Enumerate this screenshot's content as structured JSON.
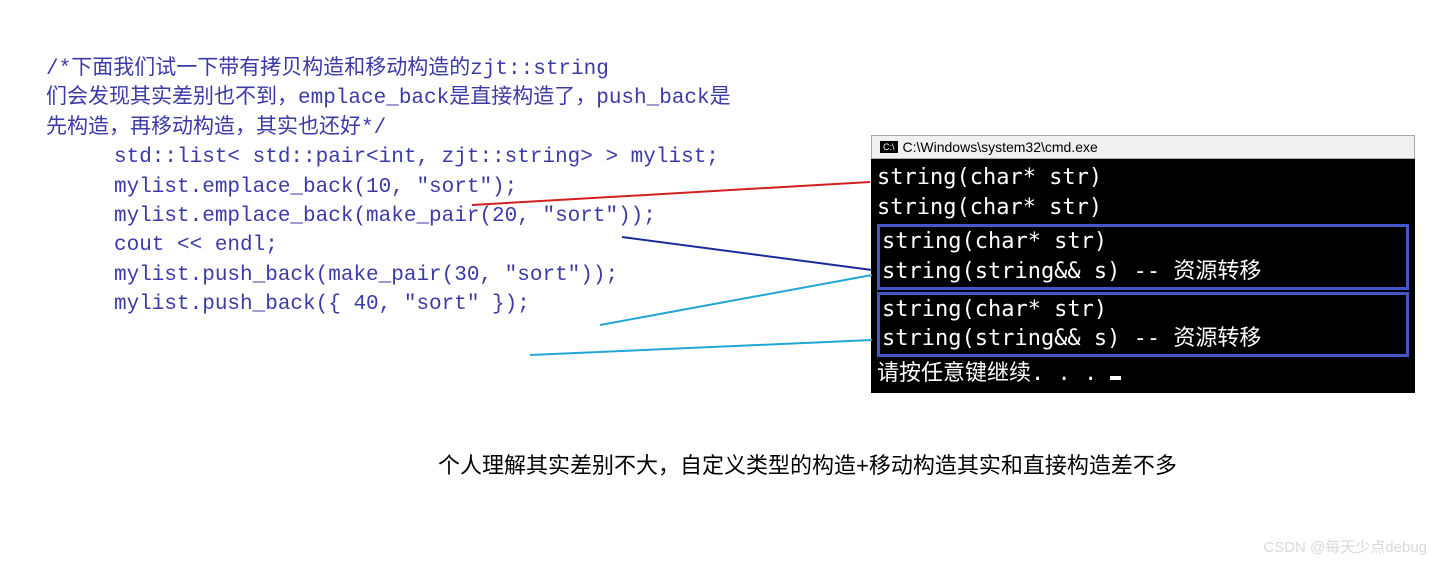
{
  "code": {
    "c1": "/*下面我们试一下带有拷贝构造和移动构造的zjt::string",
    "c2": "们会发现其实差别也不到，emplace_back是直接构造了，push_back是",
    "c3": "先构造，再移动构造，其实也还好*/",
    "l1": "std::list< std::pair<int, zjt::string> > mylist;",
    "l2": "mylist.emplace_back(10, \"sort\");",
    "l3": "mylist.emplace_back(make_pair(20, \"sort\"));",
    "l4": "cout << endl;",
    "l5": "mylist.push_back(make_pair(30, \"sort\"));",
    "l6": "mylist.push_back({ 40, \"sort\" });"
  },
  "console": {
    "title": "C:\\Windows\\system32\\cmd.exe",
    "o1": "string(char* str)",
    "o2": "string(char* str)",
    "o3a": "string(char* str)",
    "o3b": "string(string&& s) -- 资源转移",
    "o4a": "string(char* str)",
    "o4b": "string(string&& s) -- 资源转移",
    "o5": "请按任意键继续. . . "
  },
  "caption": "个人理解其实差别不大，自定义类型的构造+移动构造其实和直接构造差不多",
  "watermark": "CSDN @每天少点debug"
}
